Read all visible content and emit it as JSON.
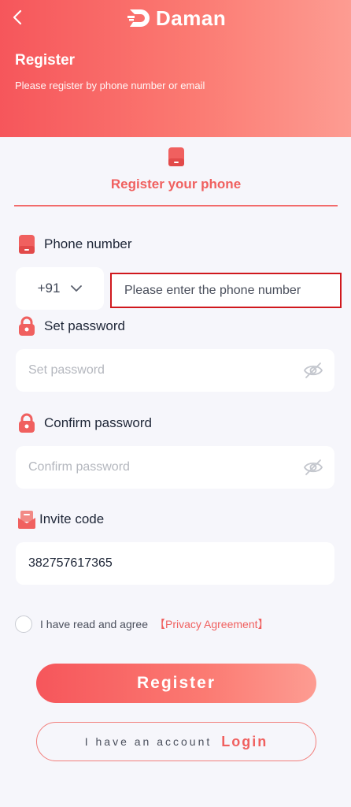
{
  "header": {
    "logo_text": "Daman",
    "title": "Register",
    "subtitle": "Please register by phone number or email"
  },
  "tab": {
    "label": "Register your phone"
  },
  "phone": {
    "label": "Phone number",
    "country_code": "+91",
    "placeholder": "Please enter the phone number",
    "value": ""
  },
  "password": {
    "label": "Set password",
    "placeholder": "Set password",
    "value": ""
  },
  "confirm_password": {
    "label": "Confirm password",
    "placeholder": "Confirm password",
    "value": ""
  },
  "invite": {
    "label": "Invite code",
    "value": "382757617365"
  },
  "agreement": {
    "text": "I have read and agree",
    "link": "【Privacy Agreement】"
  },
  "buttons": {
    "register": "Register",
    "have_account": "I have an account",
    "login": "Login"
  },
  "colors": {
    "accent": "#f0605f",
    "header_gradient_start": "#f6565b",
    "header_gradient_end": "#fd9c92",
    "highlight_border": "#d0181d",
    "background": "#f6f6fb"
  },
  "icons": {
    "back": "chevron-left-icon",
    "logo": "daman-logo-icon",
    "phone": "phone-icon",
    "lock": "lock-icon",
    "invite": "invite-card-icon",
    "eye": "eye-slash-icon",
    "dropdown": "chevron-down-icon"
  }
}
